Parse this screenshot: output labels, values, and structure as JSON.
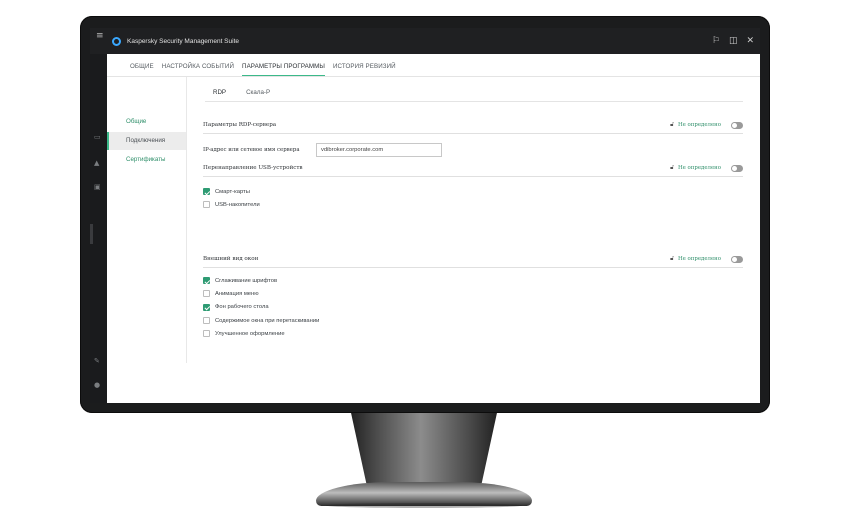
{
  "window": {
    "title": "Kaspersky Security Management Suite",
    "controls": [
      "pin-icon",
      "split-view-icon",
      "close-icon"
    ]
  },
  "tabs": [
    {
      "label": "ОБЩИЕ",
      "active": false
    },
    {
      "label": "НАСТРОЙКА СОБЫТИЙ",
      "active": false
    },
    {
      "label": "ПАРАМЕТРЫ ПРОГРАММЫ",
      "active": true
    },
    {
      "label": "ИСТОРИЯ РЕВИЗИЙ",
      "active": false
    }
  ],
  "sidemenu": {
    "items": [
      {
        "label": "Общие",
        "active": false
      },
      {
        "label": "Подключения",
        "active": true
      },
      {
        "label": "Сертификаты",
        "active": false
      }
    ]
  },
  "subtabs": [
    {
      "label": "RDP",
      "active": true
    },
    {
      "label": "Скала-Р",
      "active": false
    }
  ],
  "sections": {
    "rdp_server": {
      "title": "Параметры RDP-сервера",
      "policy": "Не определено",
      "enabled": false
    },
    "usb": {
      "title": "Перенаправление USB-устройств",
      "policy": "Не определено",
      "enabled": false
    },
    "window_view": {
      "title": "Внешний вид окон",
      "policy": "Не определено",
      "enabled": false
    }
  },
  "server_field": {
    "label": "IP-адрес или сетевое имя сервера",
    "value": "vdibroker.corporate.com"
  },
  "usb_options": [
    {
      "label": "Смарт-карты",
      "checked": true
    },
    {
      "label": "USB-накопители",
      "checked": false
    }
  ],
  "view_options": [
    {
      "label": "Сглаживание шрифтов",
      "checked": true
    },
    {
      "label": "Анимация меню",
      "checked": false
    },
    {
      "label": "Фон рабочего стола",
      "checked": true
    },
    {
      "label": "Содержимое окна при перетаскивании",
      "checked": false
    },
    {
      "label": "Улучшенное оформление",
      "checked": false
    }
  ],
  "colors": {
    "accent": "#3cb98a",
    "link": "#2f8f6a",
    "titlebar": "#1f2022",
    "checkbox_on": "#2e9b73"
  }
}
